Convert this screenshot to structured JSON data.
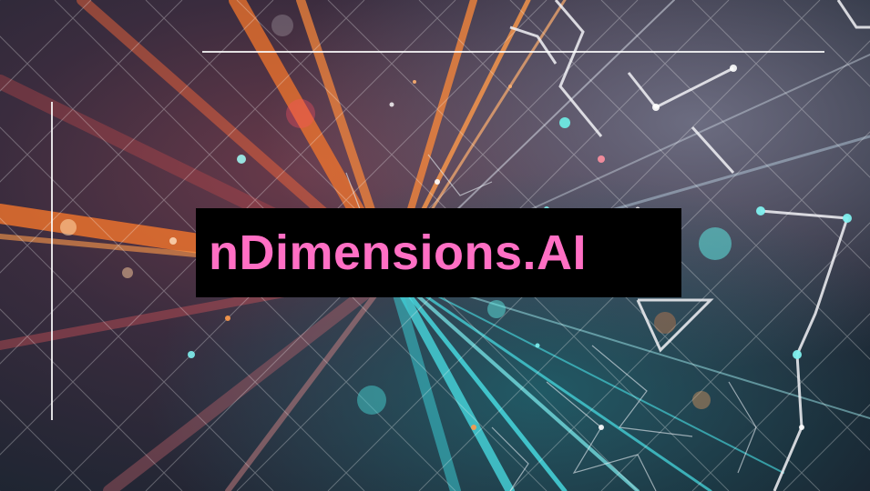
{
  "slide": {
    "title": "nDimensions.AI"
  },
  "colors": {
    "title_text": "#ff6fc4",
    "title_box": "#000000",
    "accent_orange": "#ff7a2a",
    "accent_cyan": "#49e0e6",
    "background_dark": "#1c1e2a"
  },
  "icons": {
    "background": "abstract-network-lines-image"
  }
}
